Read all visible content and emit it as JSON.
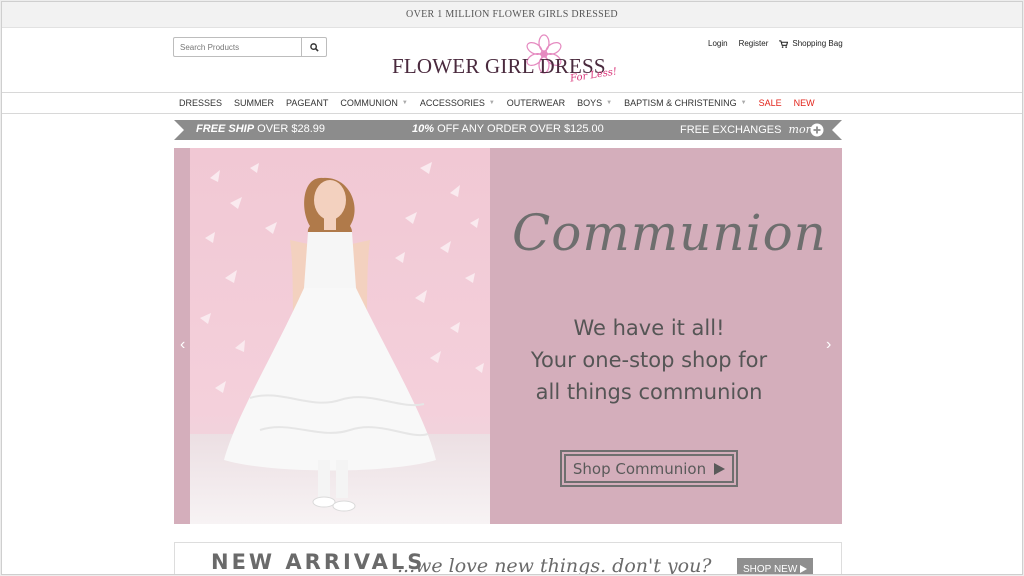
{
  "topbar": {
    "text": "OVER 1 MILLION FLOWER GIRLS DRESSED"
  },
  "search": {
    "placeholder": "Search Products"
  },
  "logo": {
    "name": "FLOWER GIRL DRESS",
    "tagline": "For Less!"
  },
  "account": {
    "login": "Login",
    "register": "Register",
    "bag": "Shopping Bag"
  },
  "nav": {
    "items": [
      {
        "label": "DRESSES"
      },
      {
        "label": "SUMMER"
      },
      {
        "label": "PAGEANT"
      },
      {
        "label": "COMMUNION"
      },
      {
        "label": "ACCESSORIES"
      },
      {
        "label": "OUTERWEAR"
      },
      {
        "label": "BOYS"
      },
      {
        "label": "BAPTISM & CHRISTENING"
      },
      {
        "label": "SALE"
      },
      {
        "label": "NEW"
      }
    ]
  },
  "promo": {
    "ship_bold": "FREE SHIP",
    "ship_rest": " OVER $28.99",
    "off_bold": "10%",
    "off_rest": " OFF ANY ORDER OVER $125.00",
    "exchanges": "FREE EXCHANGES",
    "more": "more"
  },
  "hero": {
    "headline": "Communion",
    "line1": "We have it all!",
    "line2": "Your one-stop shop for",
    "line3": "all things communion",
    "cta": "Shop Communion"
  },
  "arrivals": {
    "title": "NEW ARRIVALS",
    "tagline": "...we love new things. don't you?",
    "button": "SHOP NEW"
  },
  "colors": {
    "hero_bg": "#d4aebb",
    "sale_red": "#e2231a",
    "promo_gray": "#8c8c8c",
    "brand_pink": "#d9367a"
  }
}
